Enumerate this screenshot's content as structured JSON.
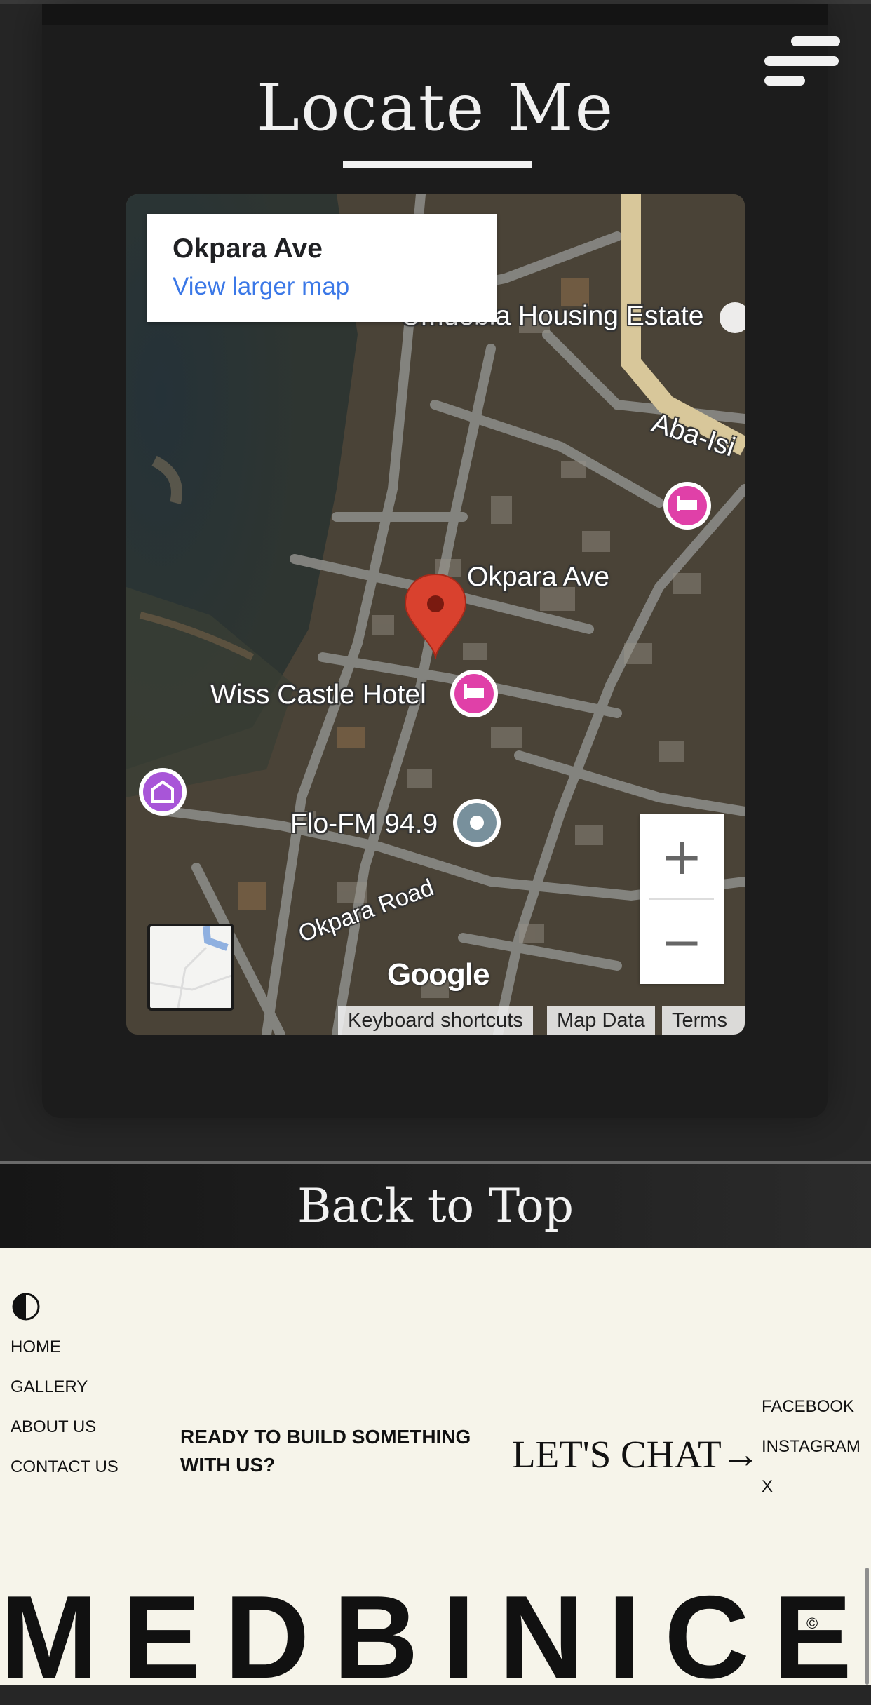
{
  "section": {
    "title": "Locate Me"
  },
  "map": {
    "info_title": "Okpara Ave",
    "view_larger": "View larger map",
    "labels": {
      "housing": "Umuobia Housing Estate",
      "road_aba": "Aba-Isi",
      "pin": "Okpara Ave",
      "hotel": "Wiss Castle Hotel",
      "radio": "Flo-FM 94.9",
      "road_okpara": "Okpara Road"
    },
    "zoom_in": "+",
    "zoom_out": "−",
    "logo": "Google",
    "attribution": {
      "shortcuts": "Keyboard shortcuts",
      "data": "Map Data",
      "terms": "Terms"
    }
  },
  "back_to_top": "Back to Top",
  "footer": {
    "theme_icon": "contrast-half-circle-icon",
    "nav": [
      "HOME",
      "GALLERY",
      "ABOUT US",
      "CONTACT US"
    ],
    "cta": "READY TO BUILD SOMETHING WITH US?",
    "chat": "LET'S CHAT→",
    "social": [
      "FACEBOOK",
      "INSTAGRAM",
      "X"
    ],
    "brand": "MEDBINICE",
    "copyright": "©"
  },
  "colors": {
    "background": "#262626",
    "card": "#1c1c1c",
    "footer": "#f6f4ea",
    "link": "#3b78e7",
    "pin": "#d9412e",
    "hotel_marker": "#e040a8",
    "museum_marker": "#a855d8"
  }
}
